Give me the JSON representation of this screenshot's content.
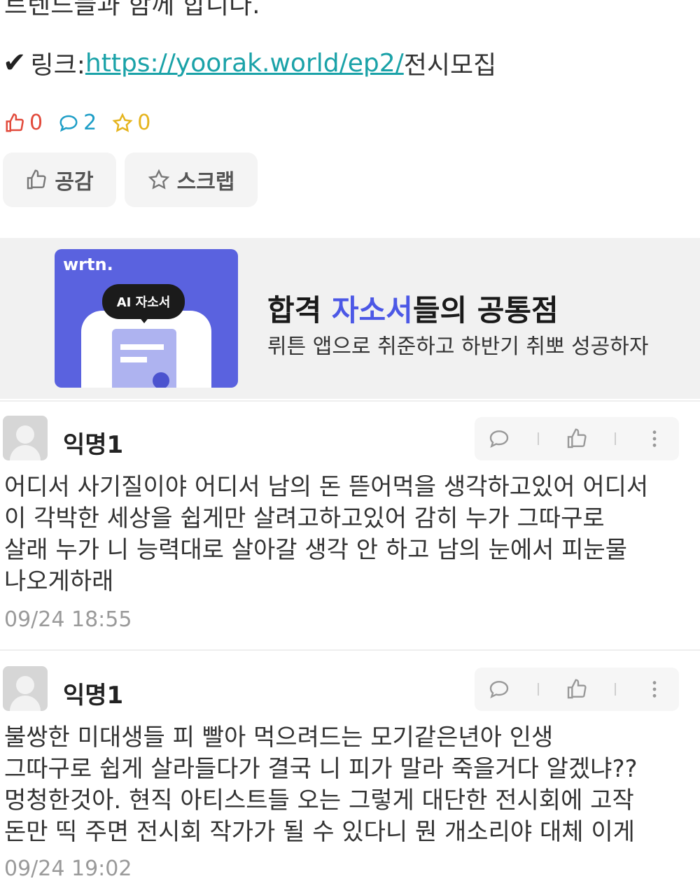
{
  "post": {
    "partial_text": "트렌드들과 함께 합니다.",
    "link_label": "링크: ",
    "link_url": "https://yoorak.world/ep2/",
    "link_suffix": "전시모집",
    "like_count": "0",
    "comment_count": "2",
    "scrap_count": "0",
    "like_button": "공감",
    "scrap_button": "스크랩"
  },
  "ad": {
    "logo": "wrtn.",
    "bubble": "AI 자소서",
    "title_part1": "합격 ",
    "title_highlight": "자소서",
    "title_part2": "들의 공통점",
    "subtitle": "뤼튼 앱으로 취준하고 하반기 취뽀 성공하자"
  },
  "comments": [
    {
      "author": "익명1",
      "lines": [
        "어디서 사기질이야 어디서 남의 돈 뜯어먹을 생각하고있어 어디서",
        "이 각박한 세상을 쉽게만 살려고하고있어 감히 누가 그따구로",
        "살래 누가 니 능력대로 살아갈 생각 안 하고 남의 눈에서 피눈물",
        "나오게하래"
      ],
      "time": "09/24 18:55"
    },
    {
      "author": "익명1",
      "lines": [
        "불쌍한 미대생들 피 빨아 먹으려드는 모기같은년아 인생",
        "그따구로 쉽게 살라들다가 결국 니 피가 말라 죽을거다 알겠냐??",
        "멍청한것아. 현직 아티스트들 오는 그렇게 대단한 전시회에 고작",
        "돈만 띡 주면 전시회 작가가 될 수 있다니 뭔 개소리야 대체 이게"
      ],
      "time": "09/24 19:02"
    }
  ],
  "colors": {
    "link": "#1aa2a8",
    "like": "#e24a3b",
    "comment": "#1e9ec7",
    "scrap": "#e5b41e",
    "ad_bg": "#5a62df",
    "ad_highlight": "#4c58e6"
  },
  "icons": [
    "checkmark-icon",
    "thumbs-up-icon",
    "speech-bubble-icon",
    "star-icon",
    "more-vertical-icon"
  ]
}
